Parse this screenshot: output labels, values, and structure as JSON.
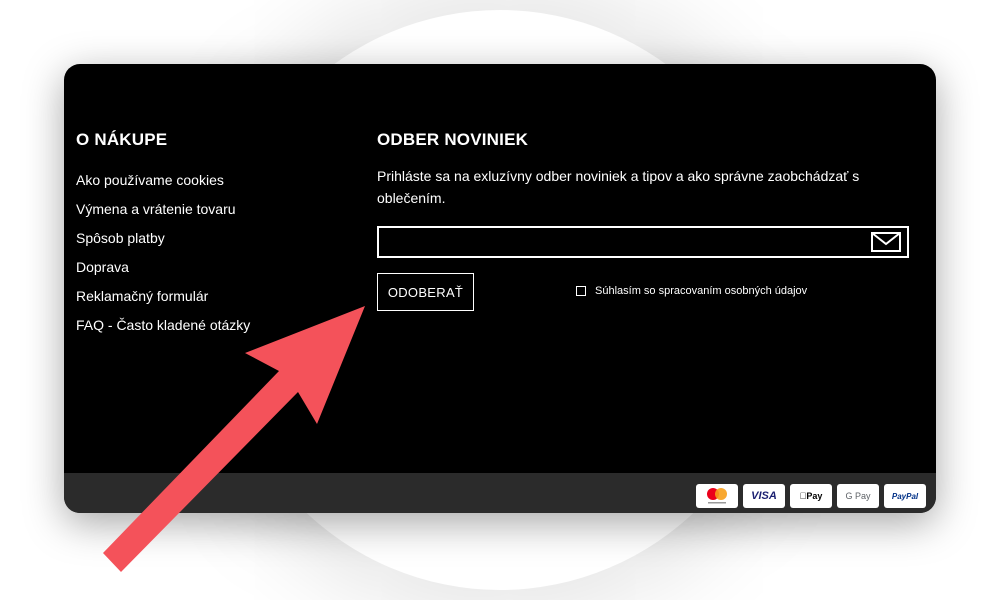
{
  "colors": {
    "footer_bg": "#000000",
    "bottom_bar_bg": "#2b2b2b",
    "text": "#ffffff",
    "annotation_arrow": "#f4525a"
  },
  "about": {
    "heading": "O NÁKUPE",
    "links": [
      "Ako používame cookies",
      "Výmena a vrátenie tovaru",
      "Spôsob platby",
      "Doprava",
      "Reklamačný formulár",
      "FAQ - Často kladené otázky"
    ]
  },
  "newsletter": {
    "heading": "ODBER NOVINIEK",
    "description": "Prihláste sa na exluzívny odber noviniek a tipov a ako správne zaobchádzať s oblečením.",
    "email_value": "",
    "email_placeholder": "",
    "submit_icon": "mail-icon",
    "subscribe_label": "ODOBERAŤ",
    "consent_label": "Súhlasím so spracovaním osobných údajov",
    "consent_checked": false
  },
  "payments": {
    "mastercard": "mastercard",
    "visa": "VISA",
    "applepay": " Pay",
    "googlepay": "G Pay",
    "paypal": "PayPal"
  }
}
